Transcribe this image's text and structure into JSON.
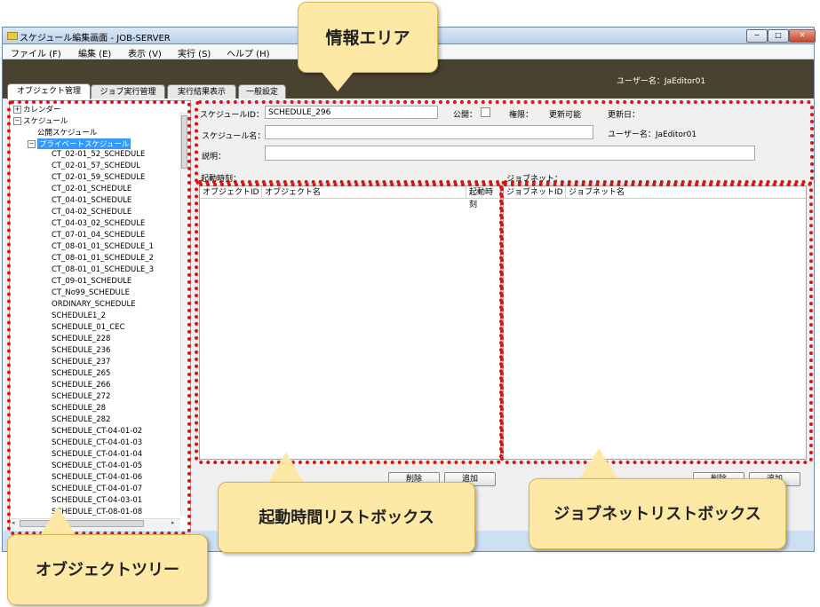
{
  "window": {
    "title": "スケジュール編集画面 - JOB-SERVER",
    "min": "−",
    "max": "□",
    "close": "✕"
  },
  "menu": [
    {
      "label": "ファイル (F)"
    },
    {
      "label": "編集 (E)"
    },
    {
      "label": "表示 (V)"
    },
    {
      "label": "実行 (S)"
    },
    {
      "label": "ヘルプ (H)"
    }
  ],
  "header": {
    "user_label": "ユーザー名：JaEditor01"
  },
  "tabs": [
    {
      "label": "オブジェクト管理"
    },
    {
      "label": "ジョブ実行管理"
    },
    {
      "label": "実行結果表示"
    },
    {
      "label": "一般設定"
    }
  ],
  "tree": {
    "calendar": "カレンダー",
    "schedule": "スケジュール",
    "public_schedule": "公開スケジュール",
    "private_schedule": "プライベートスケジュール",
    "items": [
      "CT_02-01_52_SCHEDULE",
      "CT_02-01_57_SCHEDUL",
      "CT_02-01_59_SCHEDULE",
      "CT_02-01_SCHEDULE",
      "CT_04-01_SCHEDULE",
      "CT_04-02_SCHEDULE",
      "CT_04-03_02_SCHEDULE",
      "CT_07-01_04_SCHEDULE",
      "CT_08-01_01_SCHEDULE_1",
      "CT_08-01_01_SCHEDULE_2",
      "CT_08-01_01_SCHEDULE_3",
      "CT_09-01_SCHEDULE",
      "CT_No99_SCHEDULE",
      "ORDINARY_SCHEDULE",
      "SCHEDULE1_2",
      "SCHEDULE_01_CEC",
      "SCHEDULE_228",
      "SCHEDULE_236",
      "SCHEDULE_237",
      "SCHEDULE_265",
      "SCHEDULE_266",
      "SCHEDULE_272",
      "SCHEDULE_28",
      "SCHEDULE_282",
      "SCHEDULE_CT-04-01-02",
      "SCHEDULE_CT-04-01-03",
      "SCHEDULE_CT-04-01-04",
      "SCHEDULE_CT-04-01-05",
      "SCHEDULE_CT-04-01-06",
      "SCHEDULE_CT-04-01-07",
      "SCHEDULE_CT-04-03-01",
      "SCHEDULE_CT-08-01-08"
    ]
  },
  "form": {
    "schedule_id_label": "スケジュールID：",
    "schedule_id_value": "SCHEDULE_296",
    "public_label": "公開：",
    "permission_label": "権限：",
    "permission_value": "更新可能",
    "updated_label": "更新日：",
    "schedule_name_label": "スケジュール名：",
    "schedule_name_value": "",
    "user_label": "ユーザー名：JaEditor01",
    "description_label": "説明：",
    "description_value": ""
  },
  "start_time": {
    "label": "起動時刻：",
    "columns": [
      "オブジェクトID",
      "オブジェクト名",
      "起動時刻"
    ],
    "delete_button": "削除",
    "add_button": "追加"
  },
  "jobnet": {
    "label": "ジョブネット：",
    "columns": [
      "ジョブネットID",
      "ジョブネット名"
    ],
    "delete_button": "削除",
    "add_button": "追加"
  },
  "callouts": {
    "info_area": "情報エリア",
    "object_tree": "オブジェクトツリー",
    "start_time_listbox": "起動時間リストボックス",
    "jobnet_listbox": "ジョブネットリストボックス"
  },
  "colors": {
    "annotation_red": "#e01010",
    "callout_fill": "#fde8a6",
    "selection": "#3399ff",
    "header_band": "#4a4230"
  }
}
